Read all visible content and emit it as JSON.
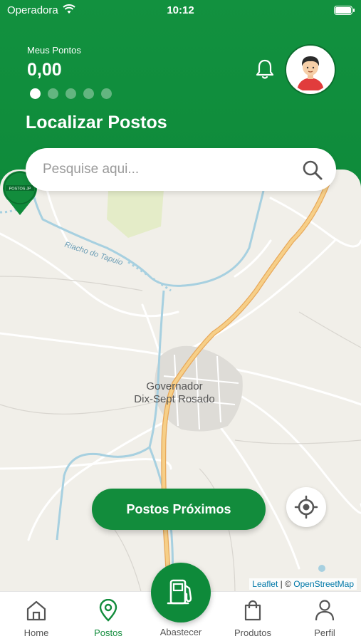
{
  "status_bar": {
    "carrier": "Operadora",
    "time": "10:12"
  },
  "header": {
    "points_label": "Meus Pontos",
    "points_value": "0,00",
    "title": "Localizar Postos",
    "carousel_dots": 5,
    "active_dot": 0
  },
  "search": {
    "placeholder": "Pesquise aqui...",
    "value": ""
  },
  "map": {
    "town_line1": "Governador",
    "town_line2": "Dix-Sept Rosado",
    "river_label": "Riacho do Tapuio",
    "marker_label": "POSTOS JP",
    "attribution_leaflet": "Leaflet",
    "attribution_sep": " | © ",
    "attribution_osm": "OpenStreetMap"
  },
  "buttons": {
    "nearby": "Postos Próximos"
  },
  "tabbar": {
    "home": "Home",
    "postos": "Postos",
    "abastecer": "Abastecer",
    "produtos": "Produtos",
    "perfil": "Perfil"
  },
  "colors": {
    "primary": "#128c3c",
    "road": "#f2c278",
    "water": "#a7d0e0"
  },
  "icons": [
    "wifi-icon",
    "bell-icon",
    "avatar-icon",
    "search-icon",
    "location-pin-icon",
    "crosshair-icon",
    "home-icon",
    "map-pin-icon",
    "fuel-pump-icon",
    "shopping-bag-icon",
    "person-icon"
  ]
}
